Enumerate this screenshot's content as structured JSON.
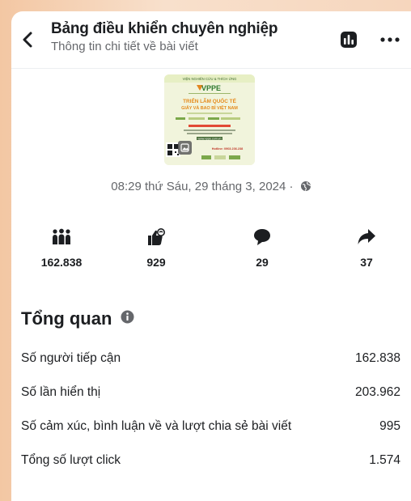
{
  "header": {
    "title": "Bảng điều khiển chuyên nghiệp",
    "subtitle": "Thông tin chi tiết về bài viết"
  },
  "post": {
    "thumbnail_texts": {
      "top": "VIỆN NGHIÊN CỨU & THÍCH ỨNG",
      "brand": "VPPE",
      "headline1": "TRIỂN LÃM QUỐC TẾ",
      "headline2": "GIẤY VÀ BAO BÌ VIỆT NAM",
      "hotline": "Hotline: 0903.236.238",
      "site": "www.vppe.com.vn"
    },
    "date": "08:29 thứ Sáu, 29 tháng 3, 2024 ·"
  },
  "stats": [
    {
      "icon": "reach-people-icon",
      "value": "162.838"
    },
    {
      "icon": "reaction-like-icon",
      "value": "929"
    },
    {
      "icon": "comment-icon",
      "value": "29"
    },
    {
      "icon": "share-icon",
      "value": "37"
    }
  ],
  "overview": {
    "title": "Tổng quan",
    "metrics": [
      {
        "label": "Số người tiếp cận",
        "value": "162.838"
      },
      {
        "label": "Số lần hiển thị",
        "value": "203.962"
      },
      {
        "label": "Số cảm xúc, bình luận về và lượt chia sẻ bài viết",
        "value": "995"
      },
      {
        "label": "Tổng số lượt click",
        "value": "1.574"
      }
    ]
  },
  "colors": {
    "primary_text": "#1c1e21",
    "secondary_text": "#65676b",
    "background_left": "#f3c7a3",
    "background_right": "#f6d6bd"
  }
}
